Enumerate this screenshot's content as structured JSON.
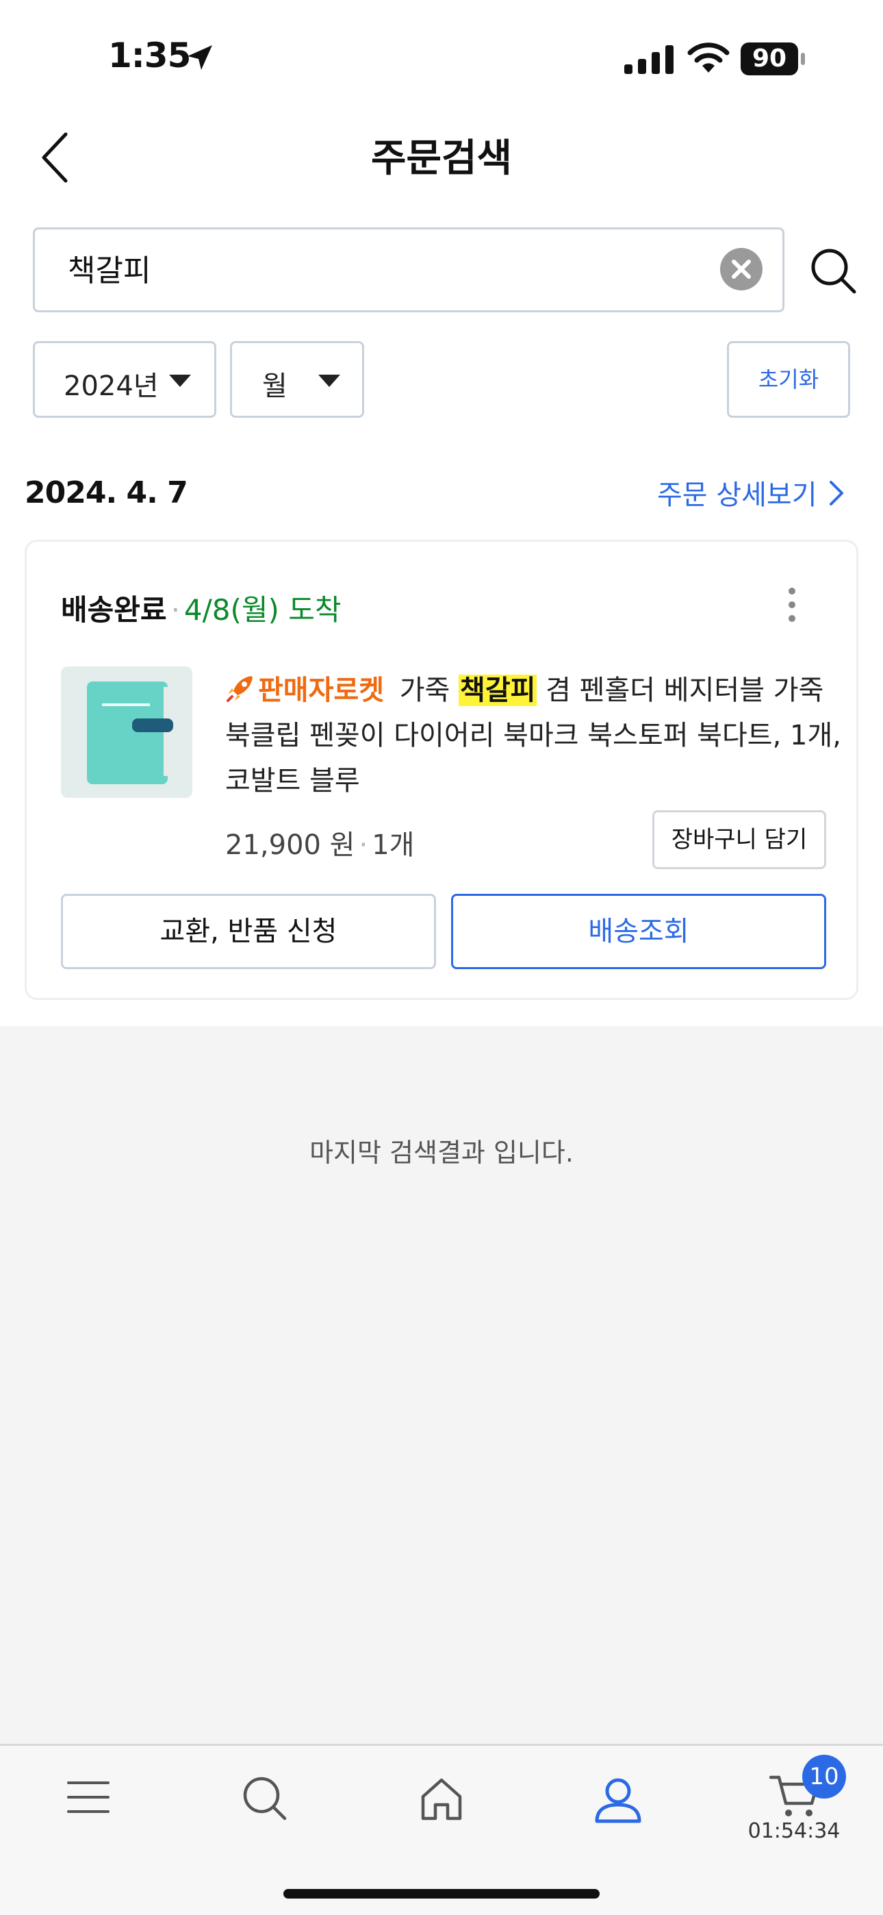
{
  "status_bar": {
    "time": "1:35",
    "battery": "90"
  },
  "header": {
    "title": "주문검색"
  },
  "search": {
    "value": "책갈피",
    "placeholder": ""
  },
  "filters": {
    "year": "2024년",
    "month": "월",
    "reset_label": "초기화"
  },
  "order": {
    "date": "2024. 4. 7",
    "detail_link": "주문 상세보기",
    "status": "배송완료",
    "arrival": "4/8(월) 도착",
    "seller_badge": "판매자로켓",
    "product_prefix": "가죽",
    "product_highlight": "책갈피",
    "product_suffix": "겸 펜홀더 베지터블 가죽 북클립 펜꽂이 다이어리 북마크 북스토퍼 북다트, 1개, 코발트 블루",
    "price": "21,900 원",
    "quantity": "1개",
    "cart_button": "장바구니 담기",
    "exchange_button": "교환, 반품 신청",
    "track_button": "배송조회"
  },
  "end_message": "마지막 검색결과 입니다.",
  "bottom_nav": {
    "cart_count": "10",
    "cart_timer": "01:54:34"
  },
  "colors": {
    "accent": "#2c6ae5",
    "arrival_green": "#0a8a2a",
    "seller_orange": "#ef6a10",
    "highlight": "#fff33a"
  }
}
